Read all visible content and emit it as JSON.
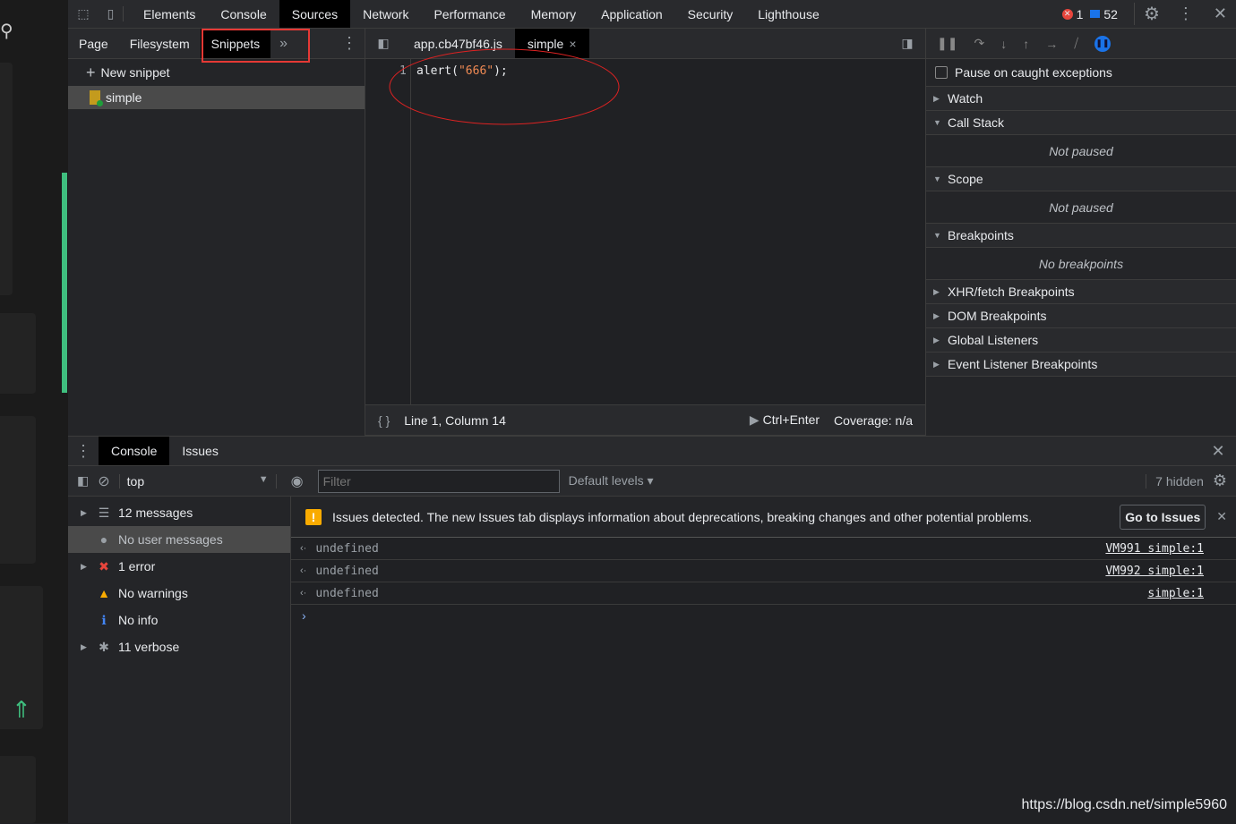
{
  "colors": {
    "accent": "#8ab4f8",
    "error": "#e8453c",
    "warning": "#f9ab00",
    "snippet_highlight": "#e53935",
    "page_accent": "#3fbf7f"
  },
  "toolbar": {
    "tabs": [
      "Elements",
      "Console",
      "Sources",
      "Network",
      "Performance",
      "Memory",
      "Application",
      "Security",
      "Lighthouse"
    ],
    "active": "Sources",
    "error_count": "1",
    "message_count": "52"
  },
  "navigator": {
    "tabs": [
      "Page",
      "Filesystem",
      "Snippets"
    ],
    "active": "Snippets",
    "more": "»",
    "new_snippet": "New snippet",
    "snippet": "simple"
  },
  "editor": {
    "tabs": [
      {
        "label": "app.cb47bf46.js"
      },
      {
        "label": "simple",
        "close": "×"
      }
    ],
    "line_number": "1",
    "code_fn": "alert(",
    "code_str": "\"666\"",
    "code_end": ");",
    "status": "Line 1, Column 14",
    "run": "Ctrl+Enter",
    "coverage": "Coverage: n/a",
    "format_icon": "{ }"
  },
  "debugger": {
    "pause_caught": "Pause on caught exceptions",
    "sections": {
      "watch": "Watch",
      "call_stack": "Call Stack",
      "call_stack_body": "Not paused",
      "scope": "Scope",
      "scope_body": "Not paused",
      "breakpoints": "Breakpoints",
      "breakpoints_body": "No breakpoints",
      "xhr": "XHR/fetch Breakpoints",
      "dom": "DOM Breakpoints",
      "global": "Global Listeners",
      "event": "Event Listener Breakpoints"
    }
  },
  "drawer": {
    "tabs": [
      "Console",
      "Issues"
    ],
    "context": "top",
    "filter_placeholder": "Filter",
    "levels": "Default levels ▾",
    "hidden": "7 hidden",
    "sidebar": [
      {
        "label": "12 messages",
        "icon": "list-icon"
      },
      {
        "label": "No user messages",
        "icon": "user-icon"
      },
      {
        "label": "1 error",
        "icon": "error-icon"
      },
      {
        "label": "No warnings",
        "icon": "warning-icon"
      },
      {
        "label": "No info",
        "icon": "info-icon"
      },
      {
        "label": "11 verbose",
        "icon": "bug-icon"
      }
    ],
    "issues_banner": "Issues detected. The new Issues tab displays information about deprecations, breaking changes and other potential problems.",
    "go_to_issues": "Go to Issues",
    "messages": [
      {
        "text": "undefined",
        "source": "VM991 simple:1"
      },
      {
        "text": "undefined",
        "source": "VM992 simple:1"
      },
      {
        "text": "undefined",
        "source": "simple:1"
      }
    ]
  },
  "watermark": "https://blog.csdn.net/simple5960"
}
